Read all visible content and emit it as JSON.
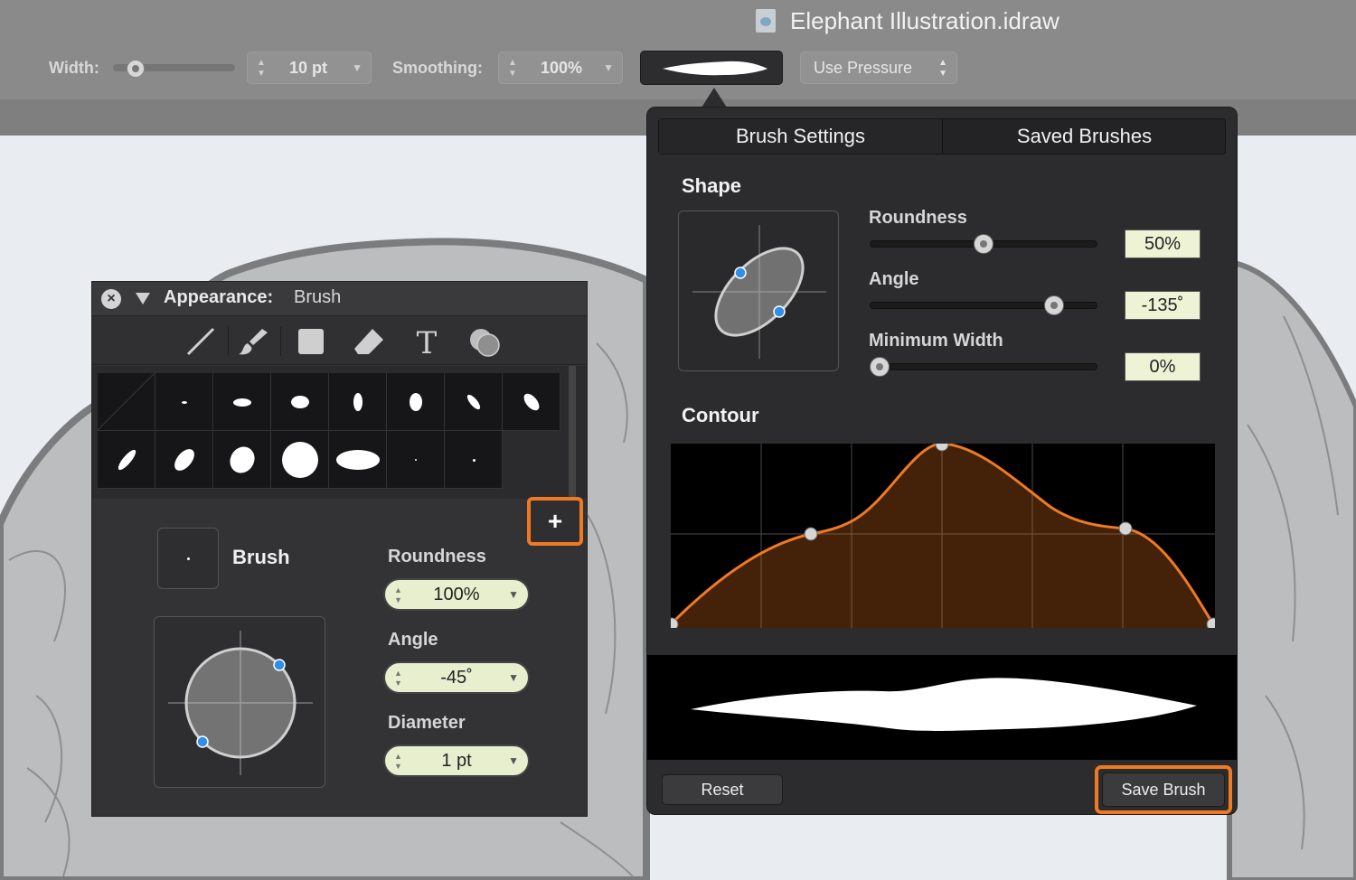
{
  "window": {
    "title": "Elephant Illustration.idraw"
  },
  "toolbar": {
    "width_label": "Width:",
    "width_value": "10 pt",
    "smoothing_label": "Smoothing:",
    "smoothing_value": "100%",
    "pressure_label": "Use Pressure"
  },
  "appearance": {
    "title": "Appearance:",
    "subtitle": "Brush",
    "tools": [
      "line-tool",
      "brush-tool",
      "rectangle-tool",
      "eraser-tool",
      "text-tool",
      "shape-combine-tool"
    ],
    "selected_tool": "brush-tool",
    "add_label": "+",
    "brush_label": "Brush",
    "roundness_label": "Roundness",
    "roundness_value": "100%",
    "angle_label": "Angle",
    "angle_value": "-45˚",
    "diameter_label": "Diameter",
    "diameter_value": "1 pt"
  },
  "brush_settings": {
    "tabs": [
      "Brush Settings",
      "Saved Brushes"
    ],
    "active_tab": "Brush Settings",
    "shape_title": "Shape",
    "roundness_label": "Roundness",
    "roundness_value": "50%",
    "roundness_level": 0.5,
    "angle_label": "Angle",
    "angle_value": "-135˚",
    "angle_level": 0.84,
    "min_width_label": "Minimum Width",
    "min_width_value": "0%",
    "min_width_level": 0.0,
    "contour_title": "Contour",
    "reset_label": "Reset",
    "save_label": "Save Brush"
  },
  "colors": {
    "accent_highlight": "#f07a22",
    "contour_curve": "#f07a22",
    "handle_blue": "#2f8fe8",
    "panel_bg": "#333336"
  }
}
